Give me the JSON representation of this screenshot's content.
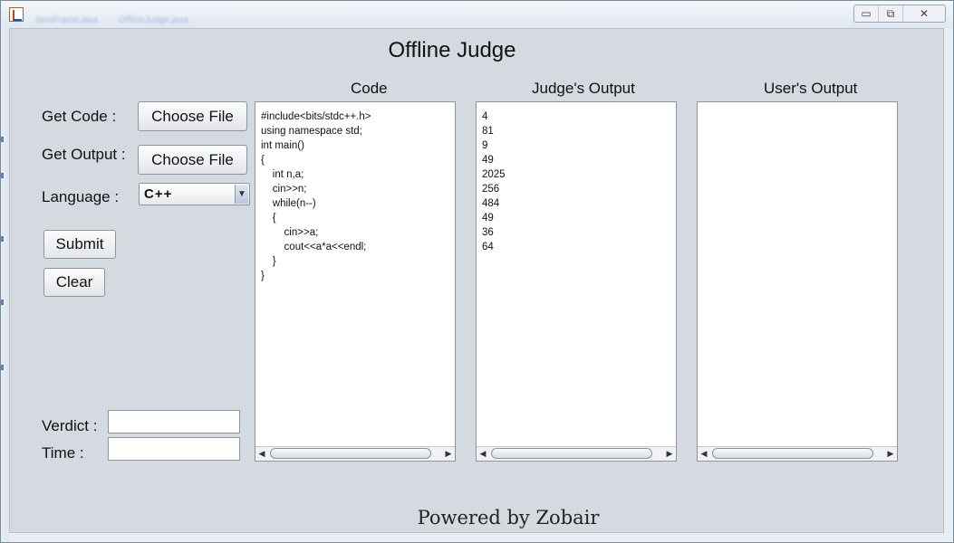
{
  "window": {
    "blurred_tab_1": "ItemFrame.java",
    "blurred_tab_2": "OfflineJudge.java",
    "controls": {
      "minimize": "▭",
      "maximize": "⧉",
      "close": "✕"
    }
  },
  "app": {
    "title": "Offline Judge",
    "labels": {
      "get_code": "Get Code :",
      "get_output": "Get Output :",
      "language": "Language :",
      "verdict": "Verdict :",
      "time": "Time :"
    },
    "buttons": {
      "choose_code": "Choose File",
      "choose_output": "Choose File",
      "submit": "Submit",
      "clear": "Clear"
    },
    "language_select": {
      "value": "C++"
    },
    "inputs": {
      "verdict": "",
      "time": ""
    },
    "columns": {
      "code": {
        "header": "Code",
        "text": "#include<bits/stdc++.h>\nusing namespace std;\nint main()\n{\n    int n,a;\n    cin>>n;\n    while(n--)\n    {\n        cin>>a;\n        cout<<a*a<<endl;\n    }\n}"
      },
      "judge_output": {
        "header": "Judge's Output",
        "text": "4\n81\n9\n49\n2025\n256\n484\n49\n36\n64"
      },
      "user_output": {
        "header": "User's Output",
        "text": ""
      }
    },
    "footer": "Powered by Zobair"
  }
}
